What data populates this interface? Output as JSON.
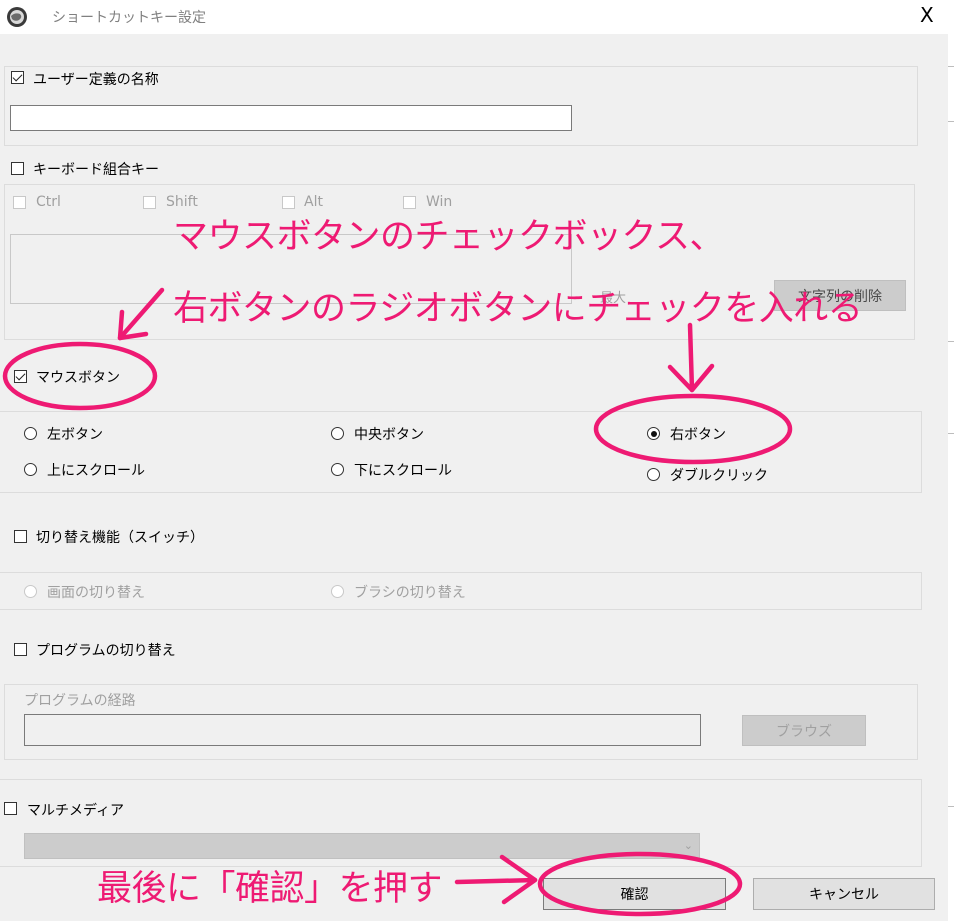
{
  "window": {
    "title": "ショートカットキー設定",
    "close_label": "X",
    "app_icon": "globe-icon"
  },
  "user_name": {
    "label": "ユーザー定義の名称",
    "checked": true,
    "value": ""
  },
  "keyboard": {
    "label": "キーボード組合キー",
    "checked": false,
    "modifiers": [
      "Ctrl",
      "Shift",
      "Alt",
      "Win"
    ],
    "hidden_button_label": "最大",
    "delete_button": "文字列の削除"
  },
  "mouse": {
    "label": "マウスボタン",
    "checked": true,
    "options": {
      "left": "左ボタン",
      "middle": "中央ボタン",
      "right": "右ボタン",
      "scroll_up": "上にスクロール",
      "scroll_down": "下にスクロール",
      "double_click": "ダブルクリック"
    },
    "selected": "right"
  },
  "switch": {
    "label": "切り替え機能（スイッチ）",
    "checked": false,
    "options": {
      "screen": "画面の切り替え",
      "brush": "ブラシの切り替え"
    }
  },
  "program": {
    "label": "プログラムの切り替え",
    "checked": false,
    "path_label": "プログラムの経路",
    "browse_button": "ブラウズ",
    "path_value": ""
  },
  "multimedia": {
    "label": "マルチメディア",
    "checked": false,
    "select_value": ""
  },
  "footer": {
    "confirm": "確認",
    "cancel": "キャンセル"
  },
  "annotations": {
    "line1": "マウスボタンのチェックボックス、",
    "line2": "右ボタンのラジオボタンにチェックを入れる",
    "bottom": "最後に「確認」を押す",
    "color": "#ee1a73"
  }
}
